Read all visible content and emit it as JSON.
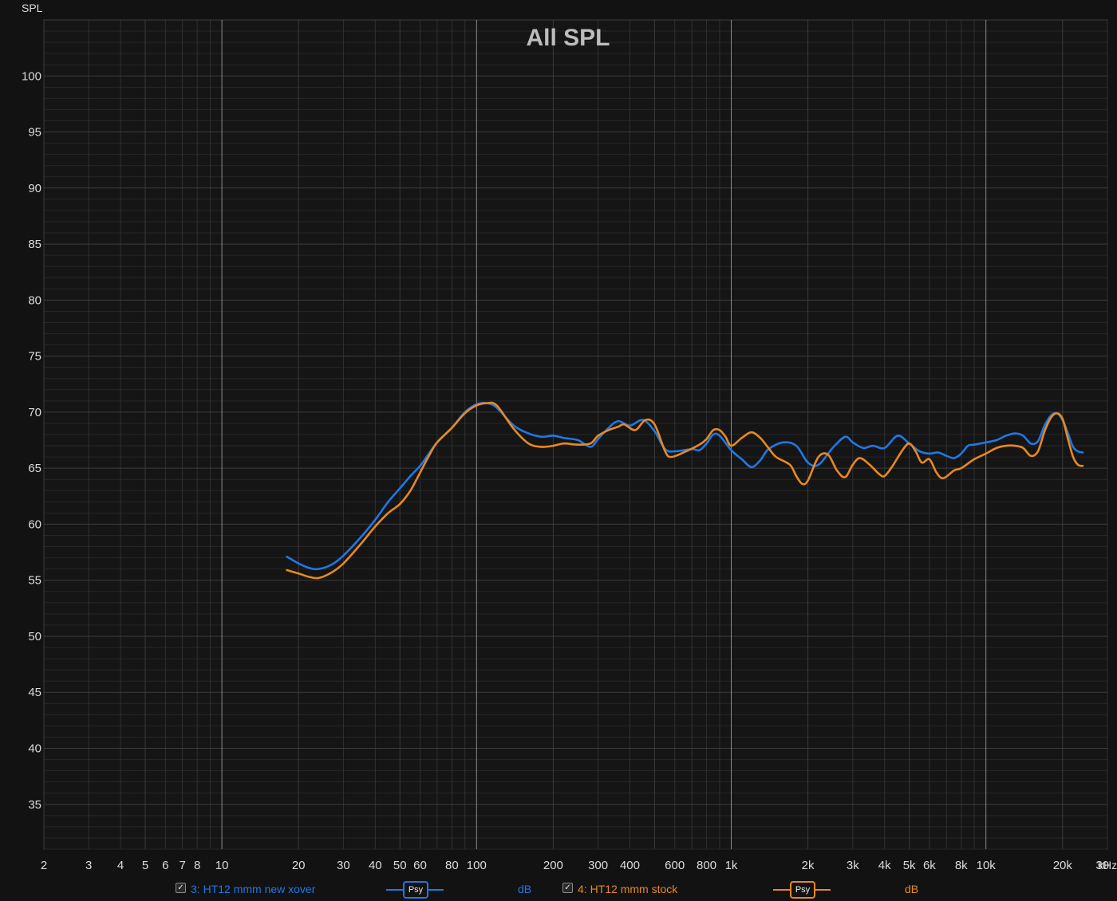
{
  "chart_data": {
    "type": "line",
    "title": "All SPL",
    "ylabel": "SPL",
    "x_unit_label": "kHz",
    "x_scale": "log",
    "xlim": [
      2,
      30000
    ],
    "ylim": [
      31,
      105
    ],
    "grid": true,
    "y_ticks": [
      35,
      40,
      45,
      50,
      55,
      60,
      65,
      70,
      75,
      80,
      85,
      90,
      95,
      100
    ],
    "x_ticks": [
      {
        "value": 2,
        "label": "2"
      },
      {
        "value": 3,
        "label": "3"
      },
      {
        "value": 4,
        "label": "4"
      },
      {
        "value": 5,
        "label": "5"
      },
      {
        "value": 6,
        "label": "6"
      },
      {
        "value": 7,
        "label": "7"
      },
      {
        "value": 8,
        "label": "8"
      },
      {
        "value": 10,
        "label": "10"
      },
      {
        "value": 20,
        "label": "20"
      },
      {
        "value": 30,
        "label": "30"
      },
      {
        "value": 40,
        "label": "40"
      },
      {
        "value": 50,
        "label": "50"
      },
      {
        "value": 60,
        "label": "60"
      },
      {
        "value": 80,
        "label": "80"
      },
      {
        "value": 100,
        "label": "100"
      },
      {
        "value": 200,
        "label": "200"
      },
      {
        "value": 300,
        "label": "300"
      },
      {
        "value": 400,
        "label": "400"
      },
      {
        "value": 600,
        "label": "600"
      },
      {
        "value": 800,
        "label": "800"
      },
      {
        "value": 1000,
        "label": "1k"
      },
      {
        "value": 2000,
        "label": "2k"
      },
      {
        "value": 3000,
        "label": "3k"
      },
      {
        "value": 4000,
        "label": "4k"
      },
      {
        "value": 5000,
        "label": "5k"
      },
      {
        "value": 6000,
        "label": "6k"
      },
      {
        "value": 8000,
        "label": "8k"
      },
      {
        "value": 10000,
        "label": "10k"
      },
      {
        "value": 20000,
        "label": "20k"
      },
      {
        "value": 30000,
        "label": "30"
      }
    ],
    "series": [
      {
        "name": "3: HT12 mmm new xover",
        "color": "#1f78e6",
        "points": [
          [
            18,
            57.1
          ],
          [
            20,
            56.5
          ],
          [
            22,
            56.1
          ],
          [
            24,
            56
          ],
          [
            27,
            56.4
          ],
          [
            30,
            57.2
          ],
          [
            35,
            58.8
          ],
          [
            40,
            60.4
          ],
          [
            45,
            62
          ],
          [
            50,
            63.2
          ],
          [
            55,
            64.3
          ],
          [
            60,
            65.2
          ],
          [
            65,
            66.3
          ],
          [
            70,
            67.3
          ],
          [
            80,
            68.6
          ],
          [
            90,
            70
          ],
          [
            100,
            70.7
          ],
          [
            110,
            70.8
          ],
          [
            120,
            70.4
          ],
          [
            140,
            68.8
          ],
          [
            160,
            68.1
          ],
          [
            180,
            67.8
          ],
          [
            200,
            67.9
          ],
          [
            220,
            67.7
          ],
          [
            250,
            67.5
          ],
          [
            280,
            66.9
          ],
          [
            300,
            67.6
          ],
          [
            330,
            68.6
          ],
          [
            360,
            69.2
          ],
          [
            400,
            68.8
          ],
          [
            450,
            69.3
          ],
          [
            500,
            68.3
          ],
          [
            550,
            66.7
          ],
          [
            600,
            66.5
          ],
          [
            700,
            66.7
          ],
          [
            750,
            66.6
          ],
          [
            800,
            67.2
          ],
          [
            850,
            68
          ],
          [
            900,
            67.9
          ],
          [
            1000,
            66.6
          ],
          [
            1100,
            65.8
          ],
          [
            1200,
            65.1
          ],
          [
            1300,
            65.7
          ],
          [
            1400,
            66.7
          ],
          [
            1600,
            67.3
          ],
          [
            1800,
            67
          ],
          [
            2000,
            65.5
          ],
          [
            2200,
            65.3
          ],
          [
            2500,
            66.8
          ],
          [
            2800,
            67.8
          ],
          [
            3000,
            67.3
          ],
          [
            3300,
            66.8
          ],
          [
            3600,
            67
          ],
          [
            4000,
            66.8
          ],
          [
            4500,
            67.9
          ],
          [
            5000,
            67.2
          ],
          [
            5500,
            66.5
          ],
          [
            6000,
            66.3
          ],
          [
            6500,
            66.4
          ],
          [
            7000,
            66.1
          ],
          [
            7500,
            65.9
          ],
          [
            8000,
            66.3
          ],
          [
            8500,
            67
          ],
          [
            9000,
            67.1
          ],
          [
            10000,
            67.3
          ],
          [
            11000,
            67.5
          ],
          [
            12000,
            67.9
          ],
          [
            13000,
            68.1
          ],
          [
            14000,
            67.9
          ],
          [
            15000,
            67.2
          ],
          [
            16000,
            67.4
          ],
          [
            17000,
            68.8
          ],
          [
            18000,
            69.7
          ],
          [
            19000,
            69.9
          ],
          [
            20000,
            69.3
          ],
          [
            21000,
            68.1
          ],
          [
            22000,
            66.9
          ],
          [
            23000,
            66.5
          ],
          [
            24000,
            66.4
          ]
        ]
      },
      {
        "name": "4: HT12 mmm stock",
        "color": "#e8891f",
        "points": [
          [
            18,
            55.9
          ],
          [
            20,
            55.6
          ],
          [
            22,
            55.3
          ],
          [
            24,
            55.2
          ],
          [
            27,
            55.7
          ],
          [
            30,
            56.5
          ],
          [
            35,
            58.2
          ],
          [
            40,
            59.8
          ],
          [
            45,
            61
          ],
          [
            50,
            61.8
          ],
          [
            55,
            63
          ],
          [
            60,
            64.6
          ],
          [
            65,
            66.1
          ],
          [
            70,
            67.3
          ],
          [
            80,
            68.6
          ],
          [
            90,
            69.9
          ],
          [
            100,
            70.6
          ],
          [
            110,
            70.8
          ],
          [
            120,
            70.6
          ],
          [
            140,
            68.5
          ],
          [
            160,
            67.2
          ],
          [
            180,
            66.9
          ],
          [
            200,
            67
          ],
          [
            220,
            67.2
          ],
          [
            250,
            67.1
          ],
          [
            280,
            67.2
          ],
          [
            300,
            67.9
          ],
          [
            330,
            68.4
          ],
          [
            360,
            68.7
          ],
          [
            380,
            68.9
          ],
          [
            420,
            68.4
          ],
          [
            460,
            69.3
          ],
          [
            500,
            68.9
          ],
          [
            550,
            66.5
          ],
          [
            580,
            66
          ],
          [
            650,
            66.4
          ],
          [
            750,
            67.1
          ],
          [
            800,
            67.6
          ],
          [
            850,
            68.4
          ],
          [
            900,
            68.4
          ],
          [
            950,
            67.8
          ],
          [
            1000,
            67
          ],
          [
            1100,
            67.7
          ],
          [
            1200,
            68.2
          ],
          [
            1300,
            67.7
          ],
          [
            1400,
            66.8
          ],
          [
            1500,
            66
          ],
          [
            1700,
            65.3
          ],
          [
            1800,
            64.3
          ],
          [
            1900,
            63.6
          ],
          [
            2000,
            63.9
          ],
          [
            2200,
            66
          ],
          [
            2400,
            66.2
          ],
          [
            2600,
            64.8
          ],
          [
            2800,
            64.2
          ],
          [
            3000,
            65.3
          ],
          [
            3200,
            65.9
          ],
          [
            3500,
            65.3
          ],
          [
            3800,
            64.5
          ],
          [
            4000,
            64.3
          ],
          [
            4300,
            65.2
          ],
          [
            4700,
            66.6
          ],
          [
            5000,
            67.2
          ],
          [
            5300,
            66.5
          ],
          [
            5600,
            65.5
          ],
          [
            6000,
            65.8
          ],
          [
            6400,
            64.6
          ],
          [
            6800,
            64.1
          ],
          [
            7500,
            64.8
          ],
          [
            8000,
            65
          ],
          [
            9000,
            65.8
          ],
          [
            10000,
            66.3
          ],
          [
            11000,
            66.8
          ],
          [
            12000,
            67
          ],
          [
            13000,
            67
          ],
          [
            14000,
            66.8
          ],
          [
            15000,
            66.1
          ],
          [
            16000,
            66.5
          ],
          [
            17000,
            68.3
          ],
          [
            18000,
            69.5
          ],
          [
            19000,
            69.9
          ],
          [
            20000,
            69.4
          ],
          [
            21000,
            67.6
          ],
          [
            22000,
            66
          ],
          [
            23000,
            65.3
          ],
          [
            24000,
            65.2
          ]
        ]
      }
    ]
  },
  "legend": [
    {
      "checked": true,
      "check_glyph": "✓",
      "label": "3: HT12 mmm new xover",
      "style_label": "Psy",
      "unit": "dB",
      "color": "#1f78e6"
    },
    {
      "checked": true,
      "check_glyph": "✓",
      "label": "4: HT12 mmm stock",
      "style_label": "Psy",
      "unit": "dB",
      "color": "#e8891f"
    }
  ]
}
